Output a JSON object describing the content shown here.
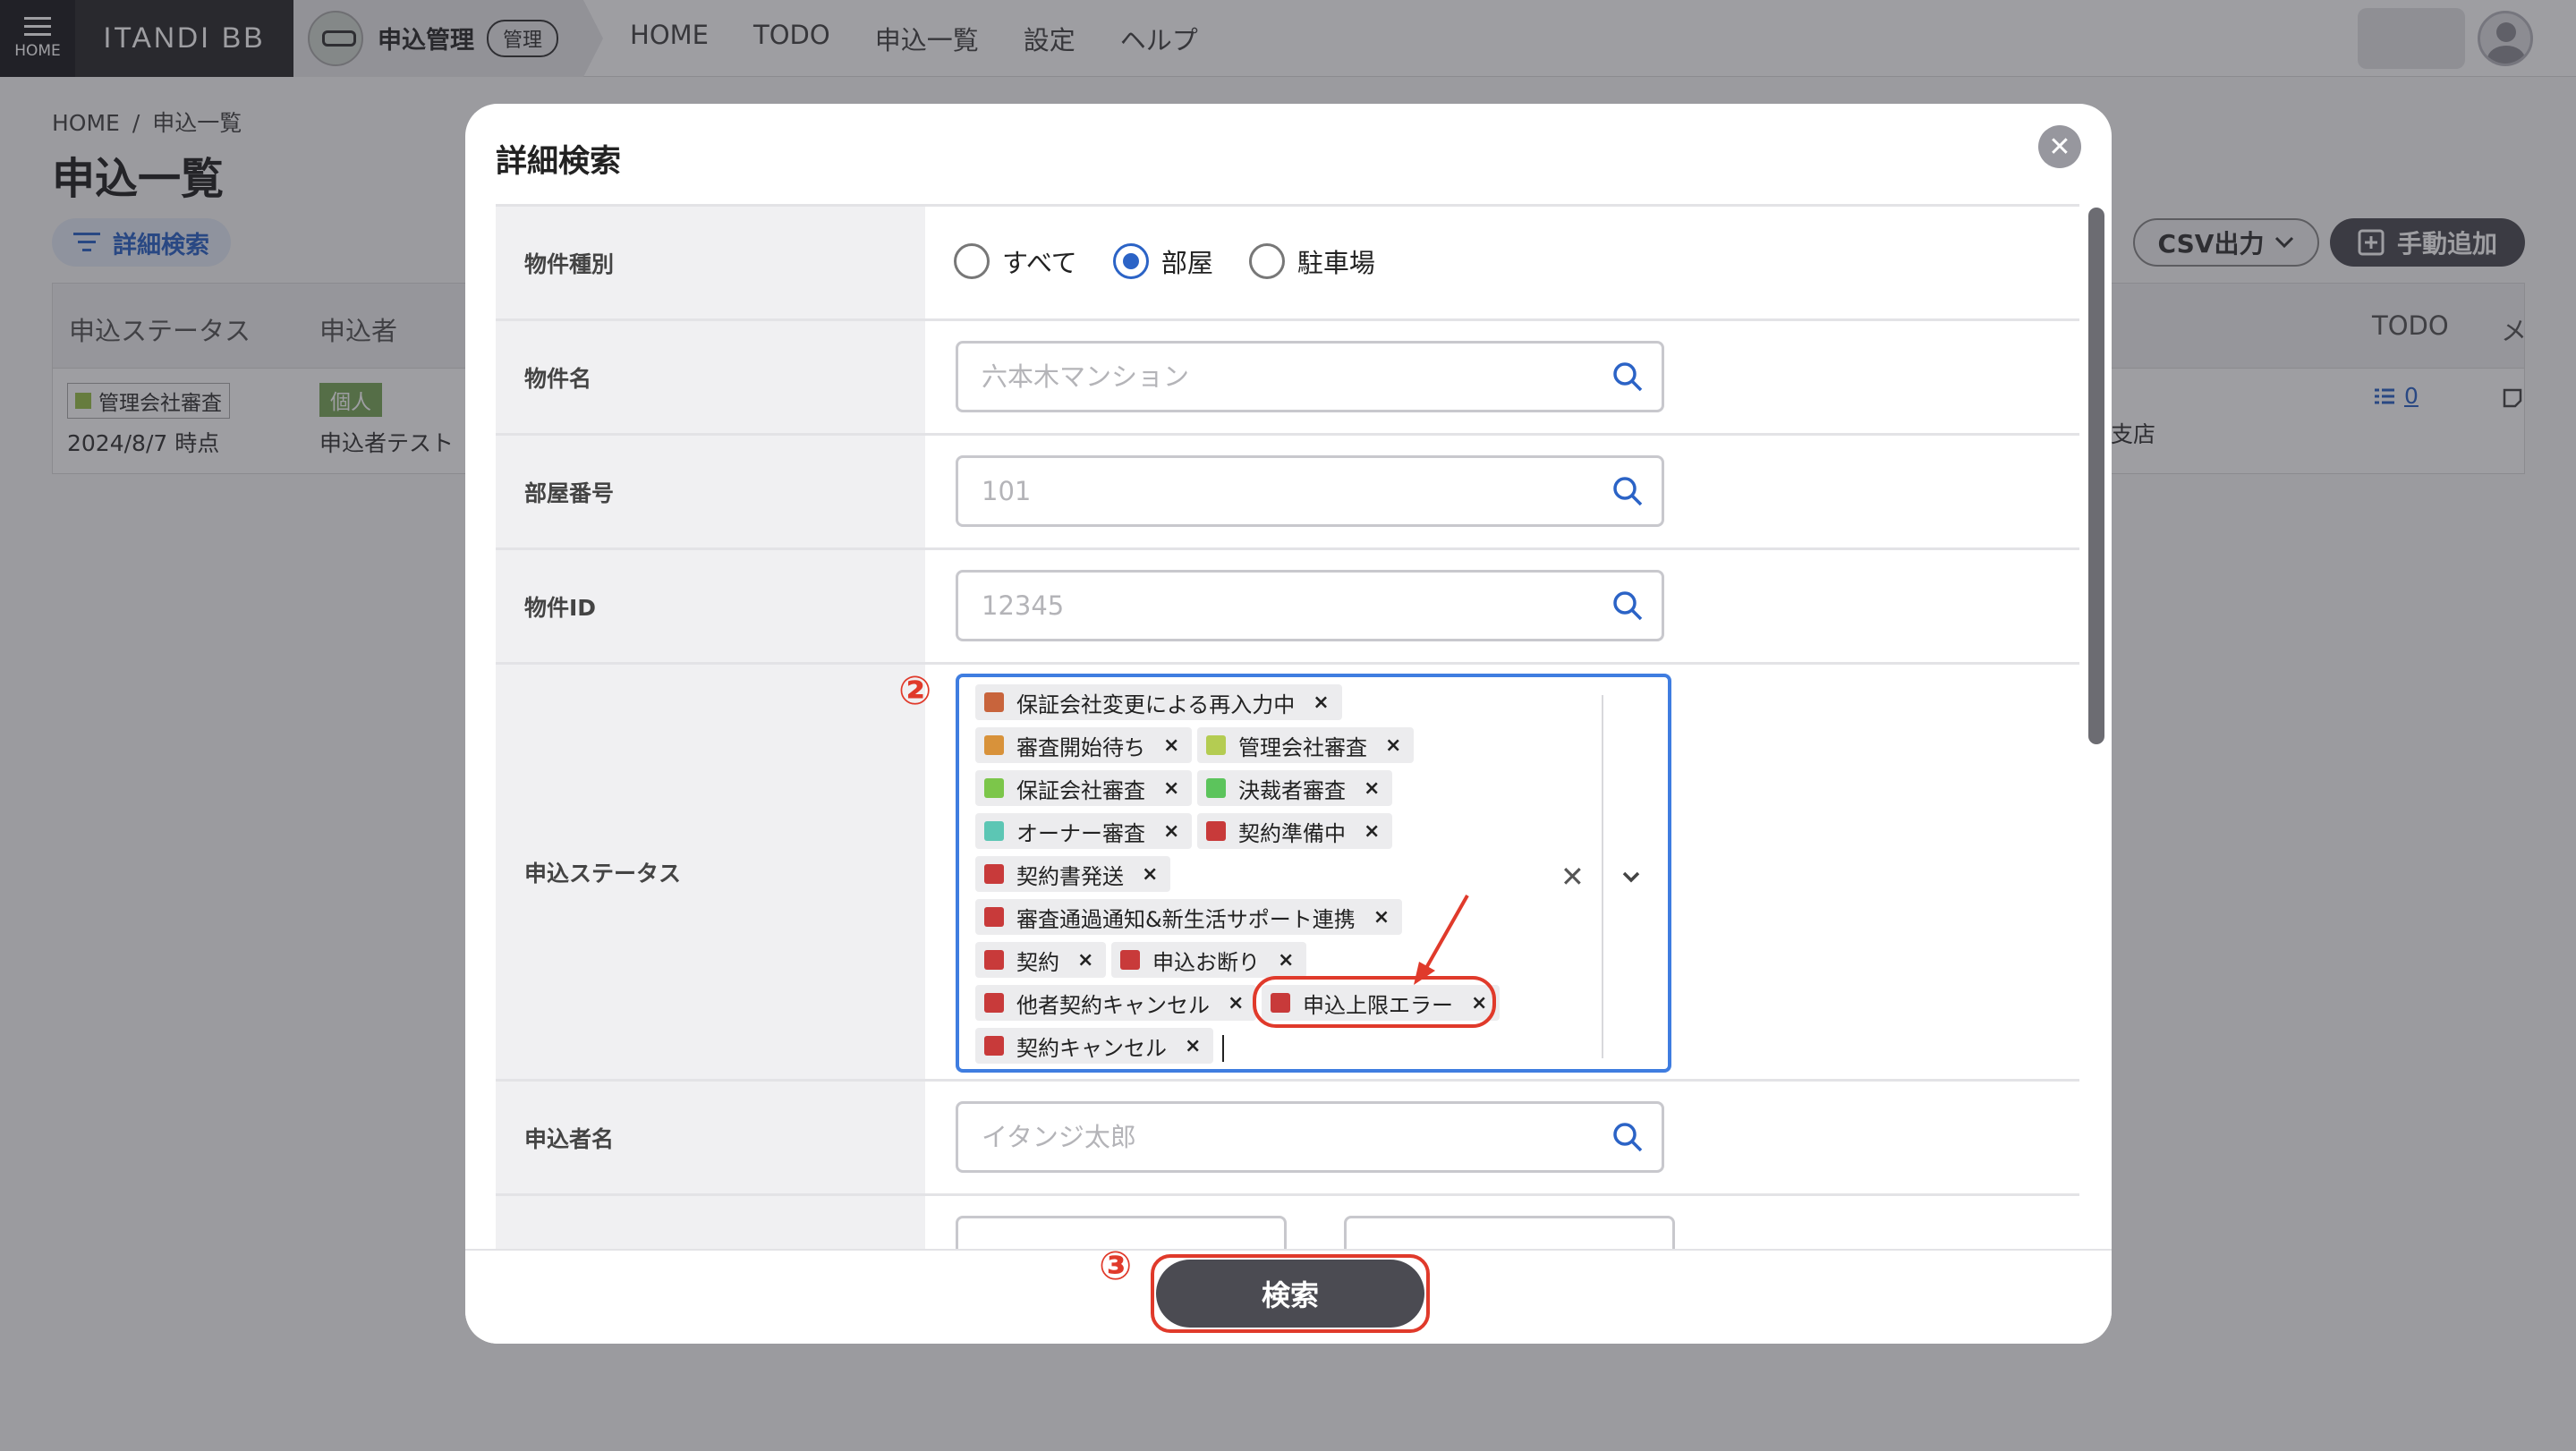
{
  "nav": {
    "home_label": "HOME",
    "brand": "ITANDI BB",
    "app_name": "申込管理",
    "app_badge": "管理",
    "links": [
      "HOME",
      "TODO",
      "申込一覧",
      "設定",
      "ヘルプ"
    ]
  },
  "background": {
    "breadcrumb": [
      "HOME",
      "申込一覧"
    ],
    "breadcrumb_sep": "/",
    "page_title": "申込一覧",
    "adv_search_label": "詳細検索",
    "csv_label": "CSV出力",
    "manual_add_label": "手動追加",
    "columns": [
      "申込ステータス",
      "申込者",
      "TODO",
      "メ"
    ],
    "row": {
      "status": "管理会社審査",
      "status_color": "#9ac24a",
      "date": "2024/8/7 時点",
      "type_badge": "個人",
      "applicant": "申込者テスト",
      "store_fragment": "支店",
      "todo_count": "0"
    }
  },
  "modal": {
    "title": "詳細検索",
    "fields": {
      "property_type": {
        "label": "物件種別",
        "options": [
          "すべて",
          "部屋",
          "駐車場"
        ],
        "selected": "部屋"
      },
      "property_name": {
        "label": "物件名",
        "placeholder": "六本木マンション"
      },
      "room_number": {
        "label": "部屋番号",
        "placeholder": "101"
      },
      "property_id": {
        "label": "物件ID",
        "placeholder": "12345"
      },
      "status": {
        "label": "申込ステータス",
        "tags": [
          {
            "label": "保証会社変更による再入力中",
            "color": "#c8643c"
          },
          {
            "label": "審査開始待ち",
            "color": "#d8923a"
          },
          {
            "label": "管理会社審査",
            "color": "#b4cc52"
          },
          {
            "label": "保証会社審査",
            "color": "#7cc64a"
          },
          {
            "label": "決裁者審査",
            "color": "#5cc45c"
          },
          {
            "label": "オーナー審査",
            "color": "#5cc6b4"
          },
          {
            "label": "契約準備中",
            "color": "#c83a3a"
          },
          {
            "label": "契約書発送",
            "color": "#c83a3a"
          },
          {
            "label": "審査通過通知&新生活サポート連携",
            "color": "#c83a3a"
          },
          {
            "label": "契約",
            "color": "#c83a3a"
          },
          {
            "label": "申込お断り",
            "color": "#c83a3a"
          },
          {
            "label": "他者契約キャンセル",
            "color": "#c83a3a"
          },
          {
            "label": "申込上限エラー",
            "color": "#c83a3a"
          },
          {
            "label": "契約キャンセル",
            "color": "#c83a3a"
          }
        ],
        "remove_glyph": "×"
      },
      "applicant_name": {
        "label": "申込者名",
        "placeholder": "イタンジ太郎"
      }
    },
    "search_button": "検索"
  },
  "annotations": {
    "step2": "②",
    "step3": "③"
  },
  "colors": {
    "accent": "#2b63c6",
    "highlight": "#e03a2b",
    "primary_button": "#4b4b52"
  }
}
